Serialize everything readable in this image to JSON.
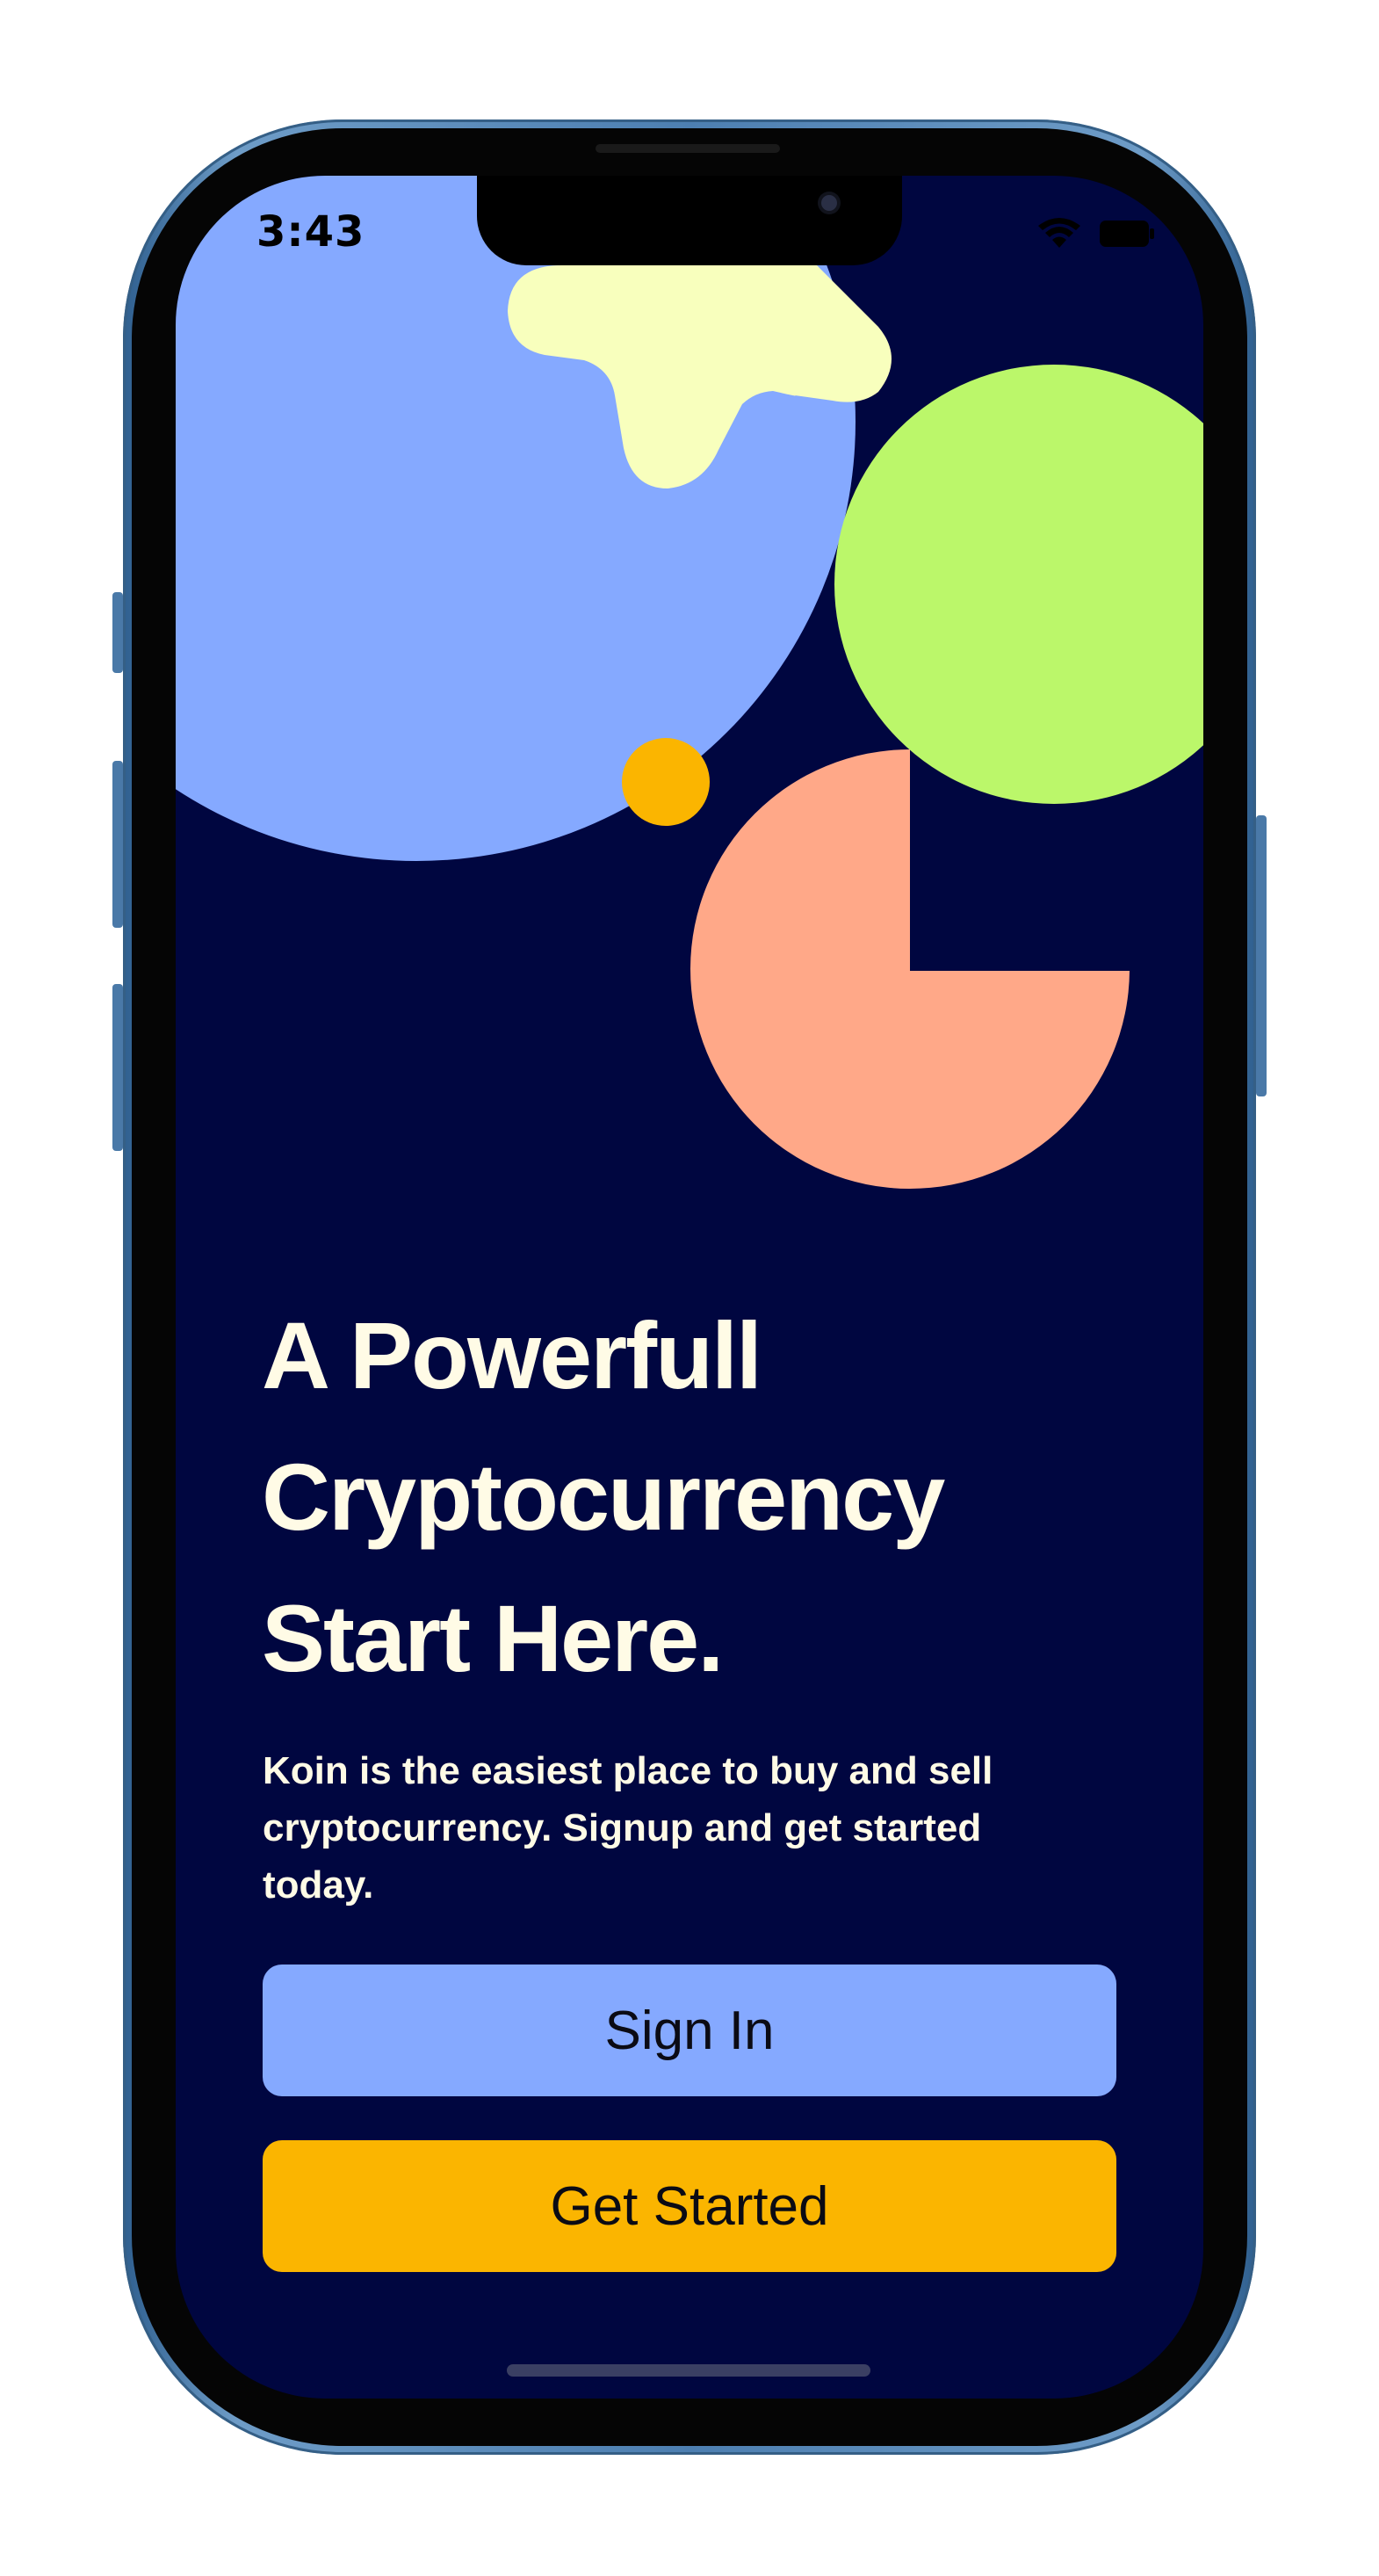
{
  "status_bar": {
    "time": "3:43"
  },
  "hero": {
    "headline_lines": [
      "A Powerfull",
      "Cryptocurrency",
      "Start Here."
    ],
    "description": "Koin is the easiest place to buy and sell cryptocurrency. Signup and get started today."
  },
  "actions": {
    "sign_in_label": "Sign In",
    "get_started_label": "Get Started"
  },
  "colors": {
    "background": "#000640",
    "periwinkle": "#85a9ff",
    "cream": "#f8ffbd",
    "lime": "#bbf76a",
    "orange": "#fbb500",
    "salmon": "#ffa888",
    "text": "#fffbe6"
  },
  "icons": [
    "wifi-icon",
    "battery-icon"
  ]
}
